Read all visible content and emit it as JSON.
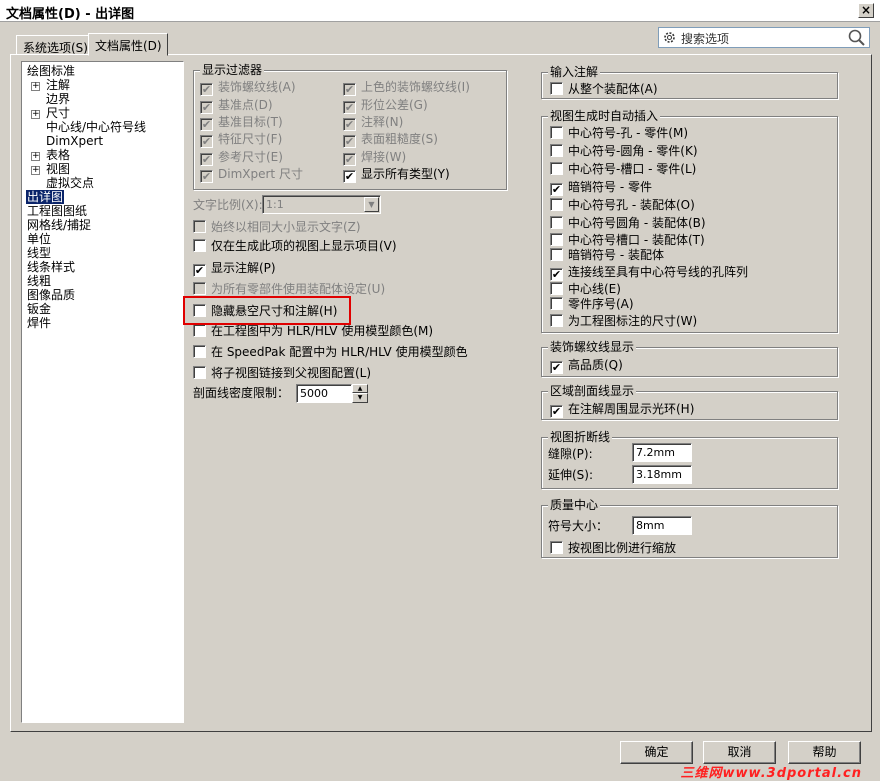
{
  "window": {
    "title": "文档属性(D) - 出详图",
    "close": "×"
  },
  "tabs": [
    {
      "label": "系统选项(S)"
    },
    {
      "label": "文档属性(D)"
    }
  ],
  "search": {
    "placeholder": "搜索选项"
  },
  "tree": {
    "items": [
      {
        "label": "绘图标准"
      },
      {
        "label": "注解",
        "expander": "+"
      },
      {
        "label": "边界"
      },
      {
        "label": "尺寸",
        "expander": "+"
      },
      {
        "label": "中心线/中心符号线"
      },
      {
        "label": "DimXpert"
      },
      {
        "label": "表格",
        "expander": "+"
      },
      {
        "label": "视图",
        "expander": "+"
      },
      {
        "label": "虚拟交点"
      },
      {
        "label": "出详图",
        "selected": true
      },
      {
        "label": "工程图图纸"
      },
      {
        "label": "网格线/捕捉"
      },
      {
        "label": "单位"
      },
      {
        "label": "线型"
      },
      {
        "label": "线条样式"
      },
      {
        "label": "线粗"
      },
      {
        "label": "图像品质"
      },
      {
        "label": "钣金"
      },
      {
        "label": "焊件"
      }
    ]
  },
  "display_filter": {
    "title": "显示过滤器",
    "items": [
      {
        "label": "装饰螺纹线(A)",
        "checked": true
      },
      {
        "label": "上色的装饰螺纹线(I)",
        "checked": true
      },
      {
        "label": "基准点(D)",
        "checked": true
      },
      {
        "label": "形位公差(G)",
        "checked": true
      },
      {
        "label": "基准目标(T)",
        "checked": true
      },
      {
        "label": "注释(N)",
        "checked": true
      },
      {
        "label": "特征尺寸(F)",
        "checked": true
      },
      {
        "label": "表面粗糙度(S)",
        "checked": true
      },
      {
        "label": "参考尺寸(E)",
        "checked": true
      },
      {
        "label": "焊接(W)",
        "checked": true
      },
      {
        "label": "DimXpert 尺寸",
        "checked": true
      },
      {
        "label": "显示所有类型(Y)",
        "checked": true
      }
    ]
  },
  "text_scale": {
    "label": "文字比例(X):",
    "value": "1:1"
  },
  "options": [
    {
      "label": "始终以相同大小显示文字(Z)",
      "checked": false,
      "disabled": true
    },
    {
      "label": "仅在生成此项的视图上显示项目(V)",
      "checked": false
    },
    {
      "label": "显示注解(P)",
      "checked": true
    },
    {
      "label": "为所有零部件使用装配体设定(U)",
      "checked": false,
      "disabled": true
    },
    {
      "label": "隐藏悬空尺寸和注解(H)",
      "checked": false
    },
    {
      "label": "在工程图中为 HLR/HLV 使用模型颜色(M)",
      "checked": false
    },
    {
      "label": "在 SpeedPak 配置中为 HLR/HLV 使用模型颜色",
      "checked": false
    },
    {
      "label": "将子视图链接到父视图配置(L)",
      "checked": false
    }
  ],
  "hatch_limit": {
    "label": "剖面线密度限制：",
    "value": "5000"
  },
  "import_annot": {
    "title": "输入注解",
    "items": [
      {
        "label": "从整个装配体(A)",
        "checked": false
      }
    ]
  },
  "auto_insert": {
    "title": "视图生成时自动插入",
    "items": [
      {
        "label": "中心符号-孔 - 零件(M)",
        "checked": false
      },
      {
        "label": "中心符号-圆角 - 零件(K)",
        "checked": false
      },
      {
        "label": "中心符号-槽口 - 零件(L)",
        "checked": false
      },
      {
        "label": "暗销符号 - 零件",
        "checked": true
      },
      {
        "label": "中心符号孔 - 装配体(O)",
        "checked": false
      },
      {
        "label": "中心符号圆角 - 装配体(B)",
        "checked": false
      },
      {
        "label": "中心符号槽口 - 装配体(T)",
        "checked": false
      },
      {
        "label": "暗销符号 - 装配体",
        "checked": false
      },
      {
        "label": "连接线至具有中心符号线的孔阵列",
        "checked": true
      },
      {
        "label": "中心线(E)",
        "checked": false
      },
      {
        "label": "零件序号(A)",
        "checked": false
      },
      {
        "label": "为工程图标注的尺寸(W)",
        "checked": false
      }
    ]
  },
  "cosmetic": {
    "title": "装饰螺纹线显示",
    "items": [
      {
        "label": "高品质(Q)",
        "checked": true
      }
    ]
  },
  "area_hatch": {
    "title": "区域剖面线显示",
    "items": [
      {
        "label": "在注解周围显示光环(H)",
        "checked": true
      }
    ]
  },
  "break_line": {
    "title": "视图折断线",
    "gap_label": "缝隙(P):",
    "gap_value": "7.2mm",
    "ext_label": "延伸(S):",
    "ext_value": "3.18mm"
  },
  "mass_center": {
    "title": "质量中心",
    "size_label": "符号大小：",
    "size_value": "8mm",
    "items": [
      {
        "label": "按视图比例进行缩放",
        "checked": false
      }
    ]
  },
  "buttons": {
    "ok": "确定",
    "cancel": "取消",
    "help": "帮助"
  },
  "watermark": "三维网www.3dportal.cn"
}
